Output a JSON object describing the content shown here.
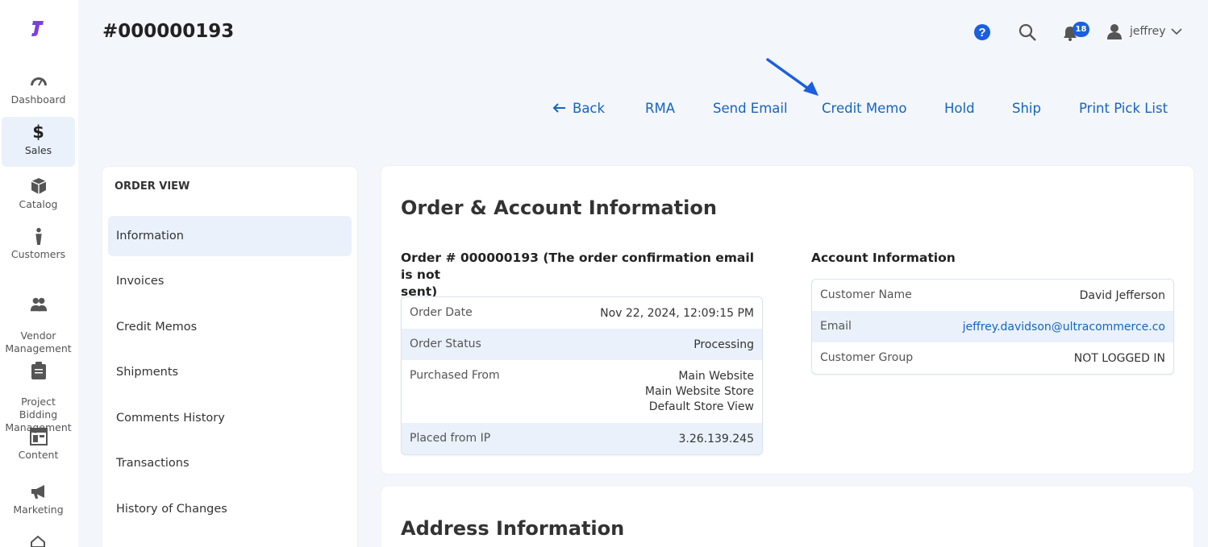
{
  "sidebar": {
    "items": [
      {
        "label": "Dashboard",
        "icon": "dashboard-icon"
      },
      {
        "label": "Sales",
        "icon": "dollar-icon",
        "active": true
      },
      {
        "label": "Catalog",
        "icon": "box-icon"
      },
      {
        "label": "Customers",
        "icon": "person-icon"
      },
      {
        "label": "Vendor\nManagement",
        "icon": "people-icon"
      },
      {
        "label": "Project\nBidding\nManagement",
        "icon": "clipboard-icon"
      },
      {
        "label": "Content",
        "icon": "layout-icon"
      },
      {
        "label": "Marketing",
        "icon": "megaphone-icon"
      }
    ]
  },
  "header": {
    "title": "#000000193",
    "notifications_count": "18",
    "user_name": "jeffrey"
  },
  "actions": {
    "back": "Back",
    "rma": "RMA",
    "send_email": "Send Email",
    "credit_memo": "Credit Memo",
    "hold": "Hold",
    "ship": "Ship",
    "print_pick_list": "Print Pick List"
  },
  "order_view": {
    "heading": "ORDER VIEW",
    "tabs": [
      "Information",
      "Invoices",
      "Credit Memos",
      "Shipments",
      "Comments History",
      "Transactions",
      "History of Changes"
    ]
  },
  "order_account": {
    "title": "Order & Account Information",
    "order_heading_line1": "Order # 000000193 (The order confirmation email is not",
    "order_heading_line2": "sent)",
    "order_rows": {
      "order_date_label": "Order Date",
      "order_date_value": "Nov 22, 2024, 12:09:15 PM",
      "order_status_label": "Order Status",
      "order_status_value": "Processing",
      "purchased_from_label": "Purchased From",
      "purchased_from_line1": "Main Website",
      "purchased_from_line2": "Main Website Store",
      "purchased_from_line3": "Default Store View",
      "placed_ip_label": "Placed from IP",
      "placed_ip_value": "3.26.139.245"
    },
    "account_heading": "Account Information",
    "account_rows": {
      "customer_name_label": "Customer Name",
      "customer_name_value": "David Jefferson",
      "email_label": "Email",
      "email_value": "jeffrey.davidson@ultracommerce.co",
      "customer_group_label": "Customer Group",
      "customer_group_value": "NOT LOGGED IN"
    }
  },
  "address": {
    "title": "Address Information"
  },
  "colors": {
    "accent": "#1565c0",
    "brand": "#7b3fe4",
    "badge": "#1a5fe0",
    "highlight_row": "#eaf1fb"
  }
}
